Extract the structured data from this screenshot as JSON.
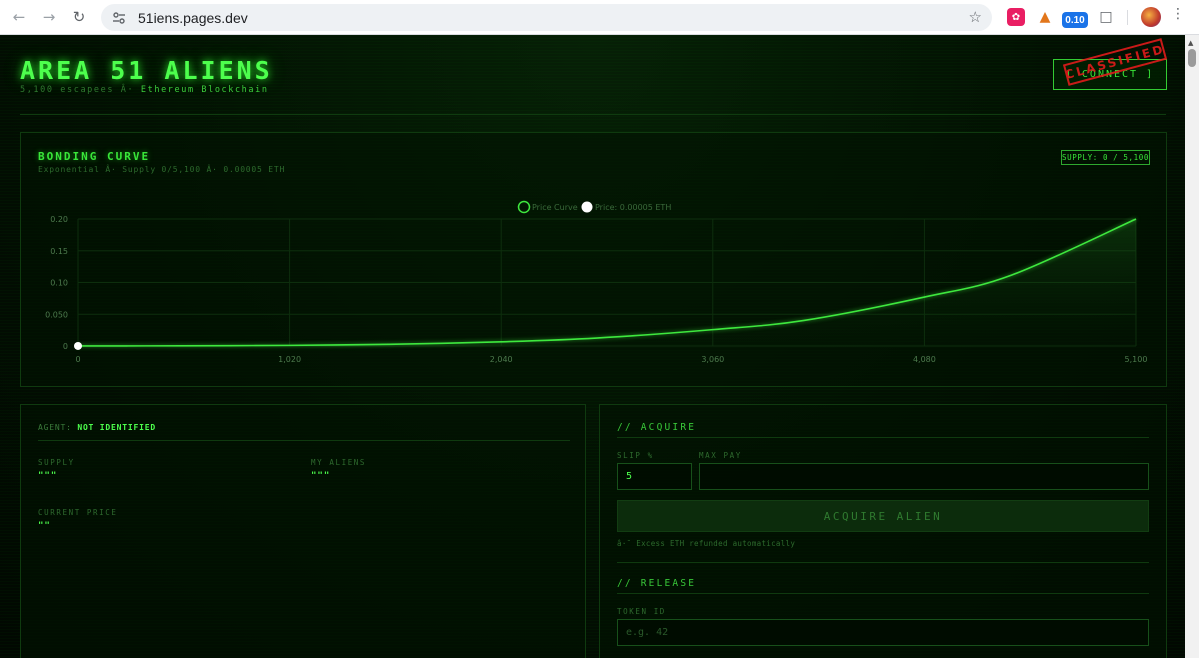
{
  "browser": {
    "url": "51iens.pages.dev",
    "badge_count": "0.10"
  },
  "site": {
    "title": "AREA 51 ALIENS",
    "subtitle_prefix": "5,100 escapees Â·",
    "subtitle_highlight": "Ethereum Blockchain",
    "connect_label": "[ CONNECT ]",
    "stamp_label": "CLASSIFIED"
  },
  "bonding": {
    "title": "BONDING CURVE",
    "subtitle": "Exponential Â· Supply 0/5,100 Â· 0.00005 ETH",
    "supply_badge": "SUPPLY: 0 / 5,100"
  },
  "chart_data": {
    "type": "line",
    "legend": [
      "Price Curve",
      "Price: 0.00005 ETH"
    ],
    "x_ticks": [
      "0",
      "1,020",
      "2,040",
      "3,060",
      "4,080",
      "5,100"
    ],
    "y_ticks": [
      "0",
      "0.050",
      "0.10",
      "0.15",
      "0.20"
    ],
    "xlim": [
      0,
      5100
    ],
    "ylim": [
      0,
      0.2
    ],
    "series": [
      {
        "name": "Price Curve",
        "x": [
          0,
          500,
          1020,
          1500,
          2040,
          2500,
          3060,
          3500,
          4080,
          4500,
          5100
        ],
        "y": [
          5e-05,
          0.0003,
          0.001,
          0.0027,
          0.0066,
          0.0125,
          0.0258,
          0.0403,
          0.0771,
          0.1116,
          0.2
        ]
      }
    ],
    "current_point": {
      "x": 0,
      "y": 5e-05
    },
    "colors": {
      "line": "#3ee83e",
      "grid": "#0d2e0d",
      "marker": "#ffffff"
    }
  },
  "agent": {
    "label": "AGENT:",
    "status": "NOT IDENTIFIED",
    "supply_label": "SUPPLY",
    "supply_value": "\"\"\"",
    "my_aliens_label": "MY ALIENS",
    "my_aliens_value": "\"\"\"",
    "price_label": "CURRENT PRICE",
    "price_value": "\"\""
  },
  "acquire": {
    "title": "// ACQUIRE",
    "slip_label": "SLIP %",
    "slip_value": "5",
    "max_pay_label": "MAX PAY",
    "max_pay_value": "",
    "button_label": "ACQUIRE ALIEN",
    "note": "â·¯ Excess ETH refunded automatically"
  },
  "release": {
    "title": "// RELEASE",
    "token_label": "TOKEN ID",
    "token_placeholder": "e.g. 42"
  }
}
